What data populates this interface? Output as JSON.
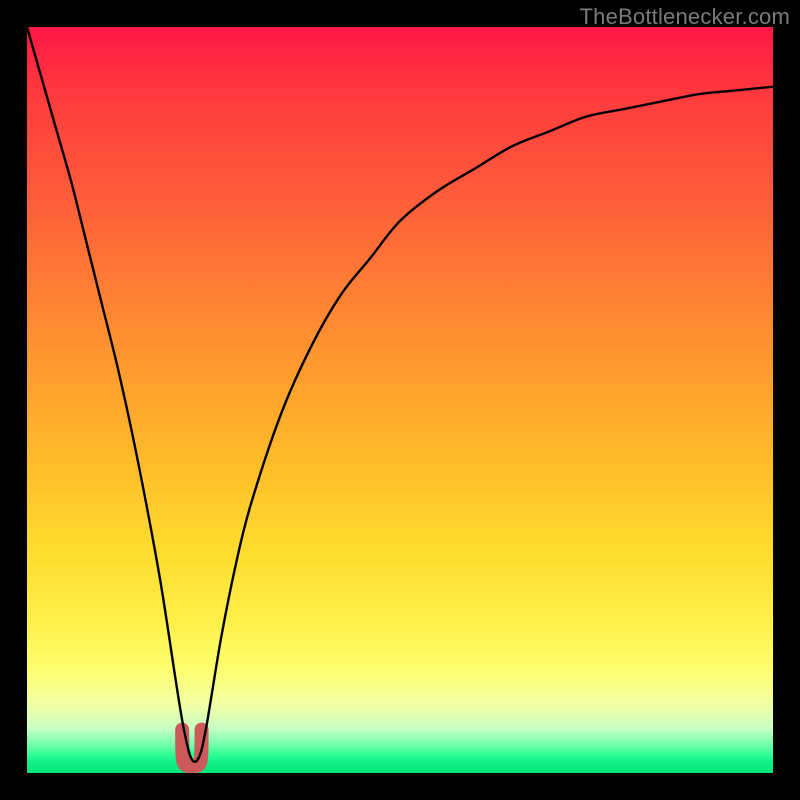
{
  "attribution": "TheBottlenecker.com",
  "chart_data": {
    "type": "line",
    "title": "",
    "xlabel": "",
    "ylabel": "",
    "xlim": [
      0,
      100
    ],
    "ylim": [
      0,
      100
    ],
    "series": [
      {
        "name": "bottleneck-curve",
        "x": [
          0,
          2,
          4,
          6,
          8,
          10,
          12,
          14,
          16,
          18,
          20,
          21,
          22,
          23,
          24,
          26,
          28,
          30,
          34,
          38,
          42,
          46,
          50,
          55,
          60,
          65,
          70,
          75,
          80,
          85,
          90,
          95,
          100
        ],
        "values": [
          100,
          93,
          86,
          79,
          71,
          63,
          55,
          46,
          36,
          25,
          12,
          6,
          2,
          2,
          6,
          18,
          28,
          36,
          48,
          57,
          64,
          69,
          74,
          78,
          81,
          84,
          86,
          88,
          89,
          90,
          91,
          91.5,
          92
        ]
      }
    ],
    "background": {
      "type": "vertical-gradient",
      "stops": [
        {
          "pos": 0.0,
          "color": "#ff1744"
        },
        {
          "pos": 0.5,
          "color": "#ffb02a"
        },
        {
          "pos": 0.85,
          "color": "#fff85a"
        },
        {
          "pos": 1.0,
          "color": "#00e676"
        }
      ]
    },
    "marker": {
      "name": "optimal-range-bump",
      "x_range": [
        20.8,
        23.4
      ],
      "y_peak": 3.4,
      "color": "#cc5a5a"
    }
  }
}
